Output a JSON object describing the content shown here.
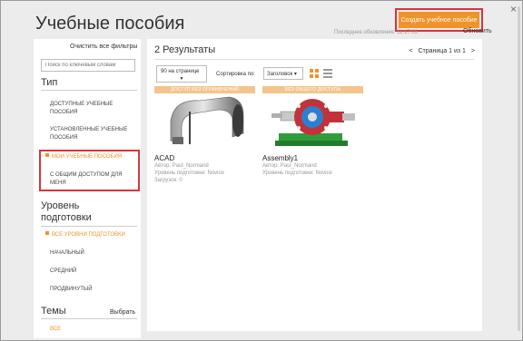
{
  "header": {
    "title": "Учебные пособия",
    "create_button": "Создать учебное пособие",
    "last_update": "Последнее обновление: 11:17:03",
    "refresh": "Обновить",
    "close": "×"
  },
  "sidebar": {
    "clear_filters": "Очистить все фильтры",
    "search_placeholder": "Поиск по ключевым словам",
    "type_title": "Тип",
    "type_items": [
      "ДОСТУПНЫЕ УЧЕБНЫЕ ПОСОБИЯ",
      "УСТАНОВЛЕННЫЕ УЧЕБНЫЕ ПОСОБИЯ",
      "МОИ УЧЕБНЫЕ ПОСОБИЯ",
      "С ОБЩИМ ДОСТУПОМ ДЛЯ МЕНЯ"
    ],
    "level_title": "Уровень подготовки",
    "level_items": [
      "ВСЕ УРОВНИ ПОДГОТОВКИ",
      "НАЧАЛЬНЫЙ",
      "СРЕДНИЙ",
      "ПРОДВИНУТЫЙ"
    ],
    "topics_title": "Темы",
    "topics_choose": "Выбрать",
    "topics_items": [
      "ВСЕ"
    ]
  },
  "main": {
    "results": "2 Результаты",
    "pager": {
      "prev": "<",
      "label": "Страница 1 из 1",
      "next": ">"
    },
    "per_page": "90 на странице",
    "sort_label": "Сортировка по:",
    "sort_value": "Заголовок ▾",
    "cards": [
      {
        "banner": "ДОСТУП БЕЗ ОГРАНИЧЕНИЙ",
        "name": "ACAD",
        "author": "Автор: Paul_Normand",
        "level": "Уровень подготовки: Novice",
        "downloads": "Загрузок: 0"
      },
      {
        "banner": "БЕЗ ОБЩЕГО ДОСТУПА",
        "name": "Assembly1",
        "author": "Автор: Paul_Normand",
        "level": "Уровень подготовки: Novice"
      }
    ]
  },
  "colors": {
    "accent": "#f0932b",
    "highlight_border": "#d9333a",
    "banner": "#f5c48c"
  }
}
